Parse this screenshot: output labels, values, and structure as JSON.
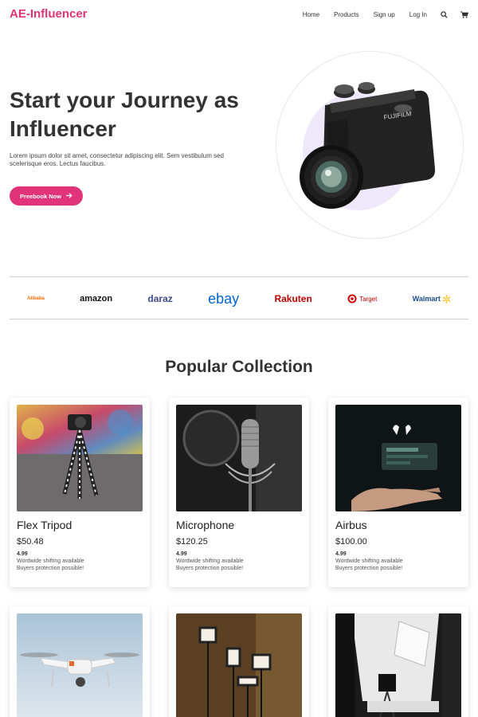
{
  "nav": {
    "brand": "AE-Influencer",
    "links": [
      "Home",
      "Products",
      "Sign up",
      "Log In"
    ],
    "icons": [
      "search-icon",
      "cart-icon"
    ]
  },
  "hero": {
    "title": "Start your Journey as Influencer",
    "text": "Lorem ipsum dolor sit amet, consectetur adipiscing elit. Sem vestibulum sed scelerisque eros. Lectus faucibus.",
    "cta": "Preebook Now",
    "accent": "#e0337a",
    "circle_bg": "#efe8fb"
  },
  "brands": [
    "Alibaba",
    "amazon",
    "daraz",
    "ebay",
    "Rakuten",
    "Target",
    "Walmart"
  ],
  "collection": {
    "title": "Popular Collection",
    "products": [
      {
        "name": "Flex Tripod",
        "price": "$50.48",
        "rating": "4.99",
        "shipping": "Wordwide shifting available",
        "protection": "Buyers protection possible!"
      },
      {
        "name": "Microphone",
        "price": "$120.25",
        "rating": "4.99",
        "shipping": "Wordwide shifting available",
        "protection": "Buyers protection possible!"
      },
      {
        "name": "Airbus",
        "price": "$100.00",
        "rating": "4.99",
        "shipping": "Wordwide shifting available",
        "protection": "Buyers protection possible!"
      },
      {
        "image": "drone"
      },
      {
        "image": "studio-lights"
      },
      {
        "image": "photo-studio"
      }
    ]
  }
}
